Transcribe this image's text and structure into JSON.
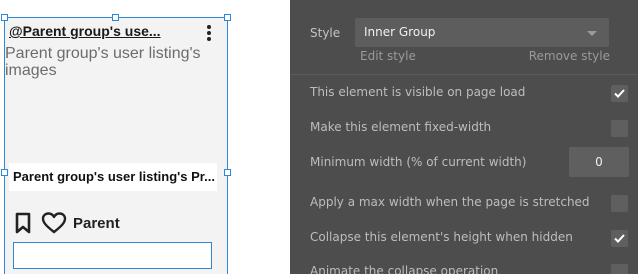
{
  "canvas": {
    "card_title": "@Parent group's use...",
    "image_text": "Parent group's user listing's images",
    "name_text": "Parent group's user listing's Pr...",
    "parent_label": "Parent",
    "icons": [
      "bookmark-icon",
      "heart-icon",
      "more-vertical-icon"
    ],
    "selection_color": "#2f86d6"
  },
  "panel": {
    "style": {
      "label": "Style",
      "value": "Inner Group",
      "edit_label": "Edit style",
      "remove_label": "Remove style"
    },
    "rows": [
      {
        "label": "This element is visible on page load",
        "control": "checkbox",
        "checked": true
      },
      {
        "label": "Make this element fixed-width",
        "control": "checkbox",
        "checked": false
      },
      {
        "label": "Minimum width (% of current width)",
        "control": "number",
        "value": "0"
      },
      {
        "label": "Apply a max width when the page is stretched",
        "control": "checkbox",
        "checked": false
      },
      {
        "label": "Collapse this element's height when hidden",
        "control": "checkbox",
        "checked": true
      },
      {
        "label": "Animate the collapse operation",
        "control": "checkbox",
        "checked": false
      }
    ],
    "background_color": "#4d4d4d"
  }
}
